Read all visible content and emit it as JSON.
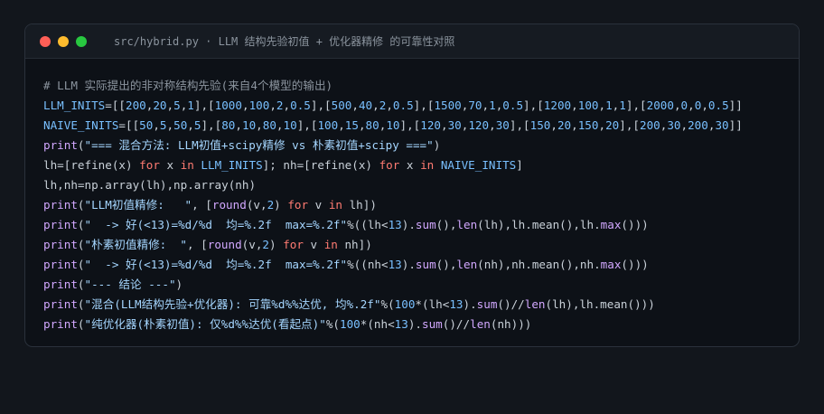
{
  "window": {
    "title": "src/hybrid.py · LLM 结构先验初值 + 优化器精修 的可靠性对照",
    "controls": {
      "close_color": "#ff5f57",
      "minimize_color": "#febc2e",
      "zoom_color": "#28c840"
    }
  },
  "code_lines": [
    [
      [
        "cm",
        "# LLM 实际提出的非对称结构先验(来自4个模型的输出)"
      ]
    ],
    [
      [
        "cst",
        "LLM_INITS"
      ],
      [
        "pl",
        "=[["
      ],
      [
        "num",
        "200"
      ],
      [
        "pl",
        ","
      ],
      [
        "num",
        "20"
      ],
      [
        "pl",
        ","
      ],
      [
        "num",
        "5"
      ],
      [
        "pl",
        ","
      ],
      [
        "num",
        "1"
      ],
      [
        "pl",
        "],["
      ],
      [
        "num",
        "1000"
      ],
      [
        "pl",
        ","
      ],
      [
        "num",
        "100"
      ],
      [
        "pl",
        ","
      ],
      [
        "num",
        "2"
      ],
      [
        "pl",
        ","
      ],
      [
        "num",
        "0.5"
      ],
      [
        "pl",
        "],["
      ],
      [
        "num",
        "500"
      ],
      [
        "pl",
        ","
      ],
      [
        "num",
        "40"
      ],
      [
        "pl",
        ","
      ],
      [
        "num",
        "2"
      ],
      [
        "pl",
        ","
      ],
      [
        "num",
        "0.5"
      ],
      [
        "pl",
        "],["
      ],
      [
        "num",
        "1500"
      ],
      [
        "pl",
        ","
      ],
      [
        "num",
        "70"
      ],
      [
        "pl",
        ","
      ],
      [
        "num",
        "1"
      ],
      [
        "pl",
        ","
      ],
      [
        "num",
        "0.5"
      ],
      [
        "pl",
        "],["
      ],
      [
        "num",
        "1200"
      ],
      [
        "pl",
        ","
      ],
      [
        "num",
        "100"
      ],
      [
        "pl",
        ","
      ],
      [
        "num",
        "1"
      ],
      [
        "pl",
        ","
      ],
      [
        "num",
        "1"
      ],
      [
        "pl",
        "],["
      ],
      [
        "num",
        "2000"
      ],
      [
        "pl",
        ","
      ],
      [
        "num",
        "0"
      ],
      [
        "pl",
        ","
      ],
      [
        "num",
        "0"
      ],
      [
        "pl",
        ","
      ],
      [
        "num",
        "0.5"
      ],
      [
        "pl",
        "]]"
      ]
    ],
    [
      [
        "cst",
        "NAIVE_INITS"
      ],
      [
        "pl",
        "=[["
      ],
      [
        "num",
        "50"
      ],
      [
        "pl",
        ","
      ],
      [
        "num",
        "5"
      ],
      [
        "pl",
        ","
      ],
      [
        "num",
        "50"
      ],
      [
        "pl",
        ","
      ],
      [
        "num",
        "5"
      ],
      [
        "pl",
        "],["
      ],
      [
        "num",
        "80"
      ],
      [
        "pl",
        ","
      ],
      [
        "num",
        "10"
      ],
      [
        "pl",
        ","
      ],
      [
        "num",
        "80"
      ],
      [
        "pl",
        ","
      ],
      [
        "num",
        "10"
      ],
      [
        "pl",
        "],["
      ],
      [
        "num",
        "100"
      ],
      [
        "pl",
        ","
      ],
      [
        "num",
        "15"
      ],
      [
        "pl",
        ","
      ],
      [
        "num",
        "80"
      ],
      [
        "pl",
        ","
      ],
      [
        "num",
        "10"
      ],
      [
        "pl",
        "],["
      ],
      [
        "num",
        "120"
      ],
      [
        "pl",
        ","
      ],
      [
        "num",
        "30"
      ],
      [
        "pl",
        ","
      ],
      [
        "num",
        "120"
      ],
      [
        "pl",
        ","
      ],
      [
        "num",
        "30"
      ],
      [
        "pl",
        "],["
      ],
      [
        "num",
        "150"
      ],
      [
        "pl",
        ","
      ],
      [
        "num",
        "20"
      ],
      [
        "pl",
        ","
      ],
      [
        "num",
        "150"
      ],
      [
        "pl",
        ","
      ],
      [
        "num",
        "20"
      ],
      [
        "pl",
        "],["
      ],
      [
        "num",
        "200"
      ],
      [
        "pl",
        ","
      ],
      [
        "num",
        "30"
      ],
      [
        "pl",
        ","
      ],
      [
        "num",
        "200"
      ],
      [
        "pl",
        ","
      ],
      [
        "num",
        "30"
      ],
      [
        "pl",
        "]]"
      ]
    ],
    [
      [
        "fn",
        "print"
      ],
      [
        "pl",
        "("
      ],
      [
        "str",
        "\"=== 混合方法: LLM初值+scipy精修 vs 朴素初值+scipy ===\""
      ],
      [
        "pl",
        ")"
      ]
    ],
    [
      [
        "pl",
        "lh=[refine(x) "
      ],
      [
        "kw",
        "for"
      ],
      [
        "pl",
        " x "
      ],
      [
        "kw",
        "in"
      ],
      [
        "pl",
        " "
      ],
      [
        "cst",
        "LLM_INITS"
      ],
      [
        "pl",
        "]; nh=[refine(x) "
      ],
      [
        "kw",
        "for"
      ],
      [
        "pl",
        " x "
      ],
      [
        "kw",
        "in"
      ],
      [
        "pl",
        " "
      ],
      [
        "cst",
        "NAIVE_INITS"
      ],
      [
        "pl",
        "]"
      ]
    ],
    [
      [
        "pl",
        "lh,nh=np.array(lh),np.array(nh)"
      ]
    ],
    [
      [
        "fn",
        "print"
      ],
      [
        "pl",
        "("
      ],
      [
        "str",
        "\"LLM初值精修:   \""
      ],
      [
        "pl",
        ", ["
      ],
      [
        "fn",
        "round"
      ],
      [
        "pl",
        "(v,"
      ],
      [
        "num",
        "2"
      ],
      [
        "pl",
        ") "
      ],
      [
        "kw",
        "for"
      ],
      [
        "pl",
        " v "
      ],
      [
        "kw",
        "in"
      ],
      [
        "pl",
        " lh])"
      ]
    ],
    [
      [
        "fn",
        "print"
      ],
      [
        "pl",
        "("
      ],
      [
        "str",
        "\"  -> 好(<13)=%d/%d  均=%.2f  max=%.2f\""
      ],
      [
        "pl",
        "%((lh<"
      ],
      [
        "num",
        "13"
      ],
      [
        "pl",
        ")."
      ],
      [
        "fn",
        "sum"
      ],
      [
        "pl",
        "(),"
      ],
      [
        "fn",
        "len"
      ],
      [
        "pl",
        "(lh),lh.mean(),lh."
      ],
      [
        "fn",
        "max"
      ],
      [
        "pl",
        "()))"
      ]
    ],
    [
      [
        "fn",
        "print"
      ],
      [
        "pl",
        "("
      ],
      [
        "str",
        "\"朴素初值精修:  \""
      ],
      [
        "pl",
        ", ["
      ],
      [
        "fn",
        "round"
      ],
      [
        "pl",
        "(v,"
      ],
      [
        "num",
        "2"
      ],
      [
        "pl",
        ") "
      ],
      [
        "kw",
        "for"
      ],
      [
        "pl",
        " v "
      ],
      [
        "kw",
        "in"
      ],
      [
        "pl",
        " nh])"
      ]
    ],
    [
      [
        "fn",
        "print"
      ],
      [
        "pl",
        "("
      ],
      [
        "str",
        "\"  -> 好(<13)=%d/%d  均=%.2f  max=%.2f\""
      ],
      [
        "pl",
        "%((nh<"
      ],
      [
        "num",
        "13"
      ],
      [
        "pl",
        ")."
      ],
      [
        "fn",
        "sum"
      ],
      [
        "pl",
        "(),"
      ],
      [
        "fn",
        "len"
      ],
      [
        "pl",
        "(nh),nh.mean(),nh."
      ],
      [
        "fn",
        "max"
      ],
      [
        "pl",
        "()))"
      ]
    ],
    [
      [
        "fn",
        "print"
      ],
      [
        "pl",
        "("
      ],
      [
        "str",
        "\"--- 结论 ---\""
      ],
      [
        "pl",
        ")"
      ]
    ],
    [
      [
        "fn",
        "print"
      ],
      [
        "pl",
        "("
      ],
      [
        "str",
        "\"混合(LLM结构先验+优化器): 可靠%d%%达优, 均%.2f\""
      ],
      [
        "pl",
        "%("
      ],
      [
        "num",
        "100"
      ],
      [
        "pl",
        "*(lh<"
      ],
      [
        "num",
        "13"
      ],
      [
        "pl",
        ")."
      ],
      [
        "fn",
        "sum"
      ],
      [
        "pl",
        "()//"
      ],
      [
        "fn",
        "len"
      ],
      [
        "pl",
        "(lh),lh.mean()))"
      ]
    ],
    [
      [
        "fn",
        "print"
      ],
      [
        "pl",
        "("
      ],
      [
        "str",
        "\"纯优化器(朴素初值): 仅%d%%达优(看起点)\""
      ],
      [
        "pl",
        "%("
      ],
      [
        "num",
        "100"
      ],
      [
        "pl",
        "*(nh<"
      ],
      [
        "num",
        "13"
      ],
      [
        "pl",
        ")."
      ],
      [
        "fn",
        "sum"
      ],
      [
        "pl",
        "()//"
      ],
      [
        "fn",
        "len"
      ],
      [
        "pl",
        "(nh)))"
      ]
    ]
  ]
}
